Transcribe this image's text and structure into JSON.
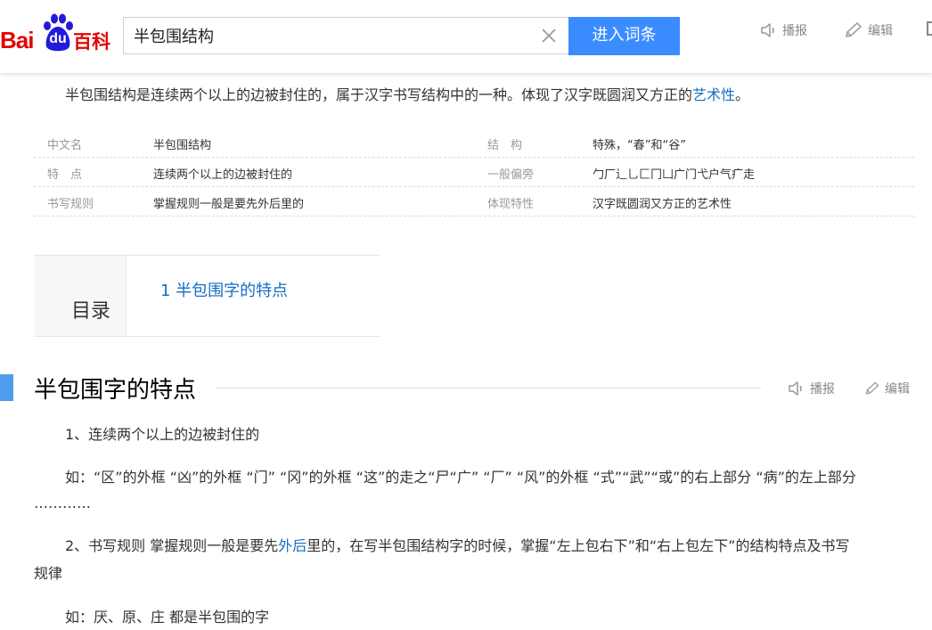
{
  "header": {
    "logo_left": "Bai",
    "logo_paw": "du",
    "logo_right": "百科",
    "search_value": "半包围结构",
    "enter_button": "进入词条",
    "broadcast": "播报",
    "edit": "编辑"
  },
  "summary": {
    "text": "半包围结构是连续两个以上的边被封住的，属于汉字书写结构中的一种。体现了汉字既圆润又方正的",
    "link": "艺术性",
    "end": "。"
  },
  "basic_info": [
    {
      "k1": "中文名",
      "v1": "半包围结构",
      "k2": "结　构",
      "v2": "特殊，“春”和“谷”"
    },
    {
      "k1": "特　点",
      "v1": "连续两个以上的边被封住的",
      "k2": "一般偏旁",
      "v2": "勹厂辶乚匚冂凵广门弋户气疒走"
    },
    {
      "k1": "书写规则",
      "v1": "掌握规则一般是要先外后里的",
      "k2": "体现特性",
      "v2": "汉字既圆润又方正的艺术性"
    }
  ],
  "catalog": {
    "title": "目录",
    "item": "1  半包围字的特点"
  },
  "section": {
    "title": "半包围字的特点",
    "broadcast": "播报",
    "edit": "编辑"
  },
  "content": {
    "p1": "1、连续两个以上的边被封住的",
    "p2": "如：“区”的外框 “凶”的外框 “门” “冈”的外框 “这”的走之“尸“广” “厂” “风”的外框 “式”“武”“或”的右上部分 “病”的左上部分",
    "p2_dots": "…………",
    "p3_a": "2、书写规则 掌握规则一般是要先",
    "p3_link": "外后",
    "p3_b": "里的，在写半包围结构字的时候，掌握“左上包右下”和“右上包左下”的结构特点及书写",
    "p3_cont": "规律",
    "p4": "如：厌、原、庄 都是半包围的字"
  },
  "colors": {
    "brand_red": "#e10601",
    "paw_blue": "#2319dc",
    "button_blue": "#3b8cff",
    "link_blue": "#136ec2",
    "section_bar": "#4f9cee"
  },
  "icons": [
    "paw-icon",
    "clear-icon",
    "speaker-icon",
    "pencil-icon"
  ]
}
